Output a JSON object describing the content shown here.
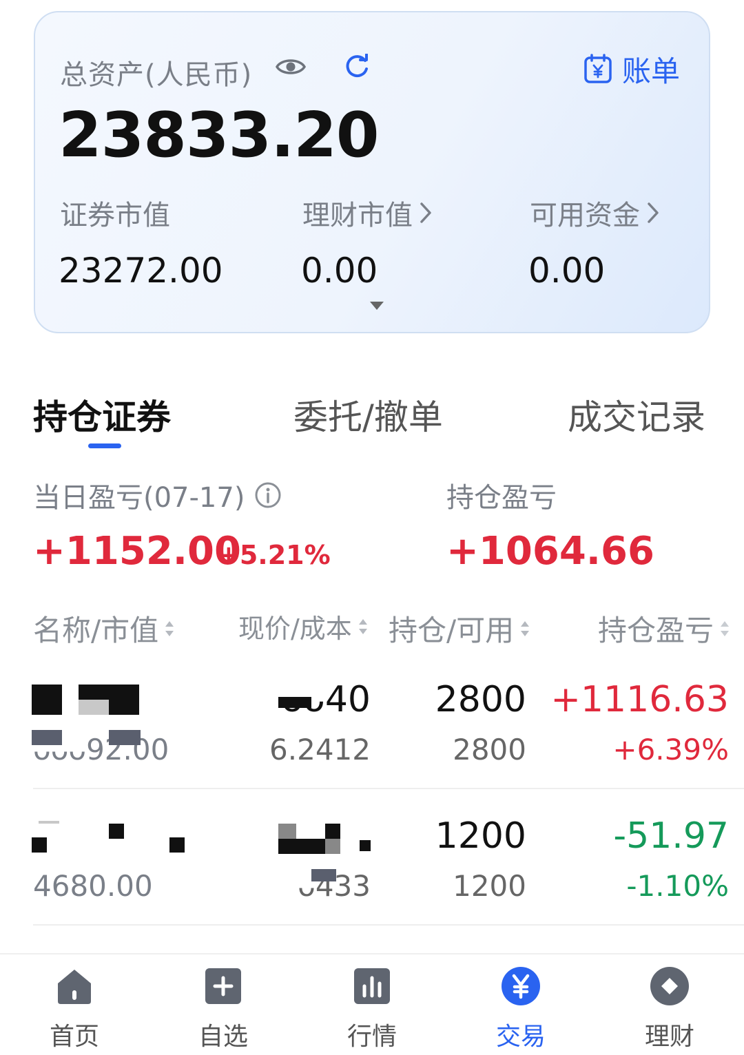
{
  "asset_card": {
    "title": "总资产(人民币)",
    "total": "23833.20",
    "bill_label": "账单",
    "metrics": [
      {
        "label": "证券市值",
        "value": "23272.00",
        "has_arrow": false
      },
      {
        "label": "理财市值",
        "value": "0.00",
        "has_arrow": true
      },
      {
        "label": "可用资金",
        "value": "0.00",
        "has_arrow": true
      }
    ]
  },
  "tabs": [
    {
      "label": "持仓证券",
      "active": true
    },
    {
      "label": "委托/撤单",
      "active": false
    },
    {
      "label": "成交记录",
      "active": false
    }
  ],
  "pl_summary": {
    "daily_label": "当日盈亏(07-17)",
    "daily_value": "+1152.00",
    "daily_pct": "+5.21%",
    "holding_label": "持仓盈亏",
    "holding_value": "+1064.66"
  },
  "table_headers": [
    "名称/市值",
    "现价/成本",
    "持仓/可用",
    "持仓盈亏"
  ],
  "holdings": [
    {
      "name": "",
      "market_value": "ᴗᴗᴗ92.00",
      "price": "ᴗᴗ40",
      "cost": "6.2412",
      "position": "2800",
      "available": "2800",
      "pl": "+1116.63",
      "pl_pct": "+6.39%",
      "direction": "up"
    },
    {
      "name": "",
      "market_value": "4680.00",
      "price": "",
      "cost": "ᴗ433",
      "position": "1200",
      "available": "1200",
      "pl": "-51.97",
      "pl_pct": "-1.10%",
      "direction": "down"
    }
  ],
  "bottom_nav": [
    {
      "label": "首页",
      "icon": "home-icon"
    },
    {
      "label": "自选",
      "icon": "add-watchlist-icon"
    },
    {
      "label": "行情",
      "icon": "market-chart-icon"
    },
    {
      "label": "交易",
      "icon": "yuan-trade-icon",
      "active": true
    },
    {
      "label": "理财",
      "icon": "wealth-diamond-icon"
    }
  ],
  "colors": {
    "accent": "#2a63f0",
    "up": "#e0293c",
    "down": "#159a5a",
    "muted": "#7a7f88"
  }
}
